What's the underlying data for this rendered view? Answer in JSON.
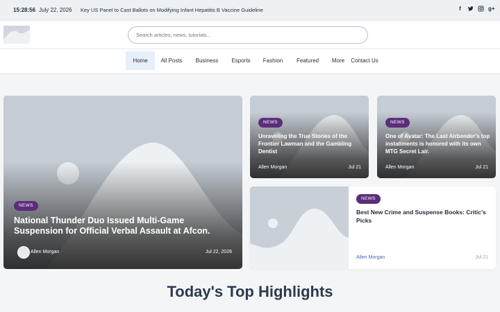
{
  "topbar": {
    "time": "15:28:56",
    "date": "July 22, 2026",
    "ticker": "Key US Panel to Cast Ballots on Modifying Infant Hepatitis B Vaccine Guideline",
    "socials": [
      "f",
      "t",
      "o",
      "g+"
    ]
  },
  "header": {
    "search_placeholder": "Search articles, news, tutorials..."
  },
  "nav": {
    "items": [
      "Home",
      "All Posts",
      "Business",
      "Esports",
      "Fashion",
      "Featured",
      "More",
      "Contact Us"
    ]
  },
  "featured": {
    "main": {
      "badge": "NEWS",
      "title": "National Thunder Duo Issued Multi-Game Suspension for Official Verbal Assault at Afcon.",
      "author": "Allen Morgan",
      "date": "Jul 22, 2026"
    },
    "card2": {
      "badge": "NEWS",
      "title": "Unraveling the True Stories of the Frontier Lawman and the Gambling Dentist",
      "author": "Allen Morgan",
      "date": "Jul 21"
    },
    "card3": {
      "badge": "NEWS",
      "title": "One of Avatar: The Last Airbender's top installments is honored with its own MTG Secret Lair.",
      "author": "Allen Morgan",
      "date": "Jul 21"
    },
    "card4": {
      "badge": "NEWS",
      "title": "Best New Crime and Suspense Books: Critic's Picks",
      "author": "Allen Morgan",
      "date": "Jul 21"
    }
  },
  "highlights": {
    "title": "Today's Top Highlights"
  },
  "colors": {
    "badge": "#5b2d7a",
    "nav_active": "#e7eff8",
    "author_link": "#4a67b8"
  }
}
